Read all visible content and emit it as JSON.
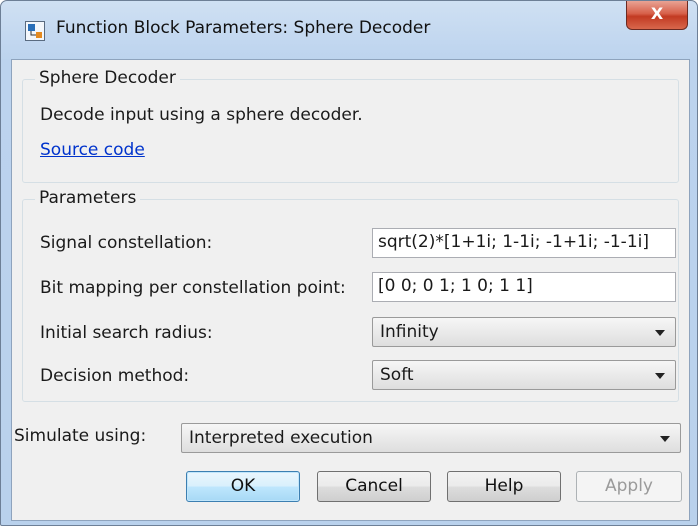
{
  "window": {
    "title": "Function Block Parameters: Sphere Decoder",
    "close_symbol": "X"
  },
  "block": {
    "group_title": "Sphere Decoder",
    "description": "Decode input using a sphere decoder.",
    "source_link": "Source code"
  },
  "parameters": {
    "group_title": "Parameters",
    "signal_constellation": {
      "label": "Signal constellation:",
      "value": "sqrt(2)*[1+1i; 1-1i; -1+1i; -1-1i]"
    },
    "bit_mapping": {
      "label": "Bit mapping per constellation point:",
      "value": "[0 0; 0 1; 1 0; 1 1]"
    },
    "initial_search_radius": {
      "label": "Initial search radius:",
      "value": "Infinity"
    },
    "decision_method": {
      "label": "Decision method:",
      "value": "Soft"
    }
  },
  "simulate": {
    "label": "Simulate using:",
    "value": "Interpreted execution"
  },
  "buttons": {
    "ok": "OK",
    "cancel": "Cancel",
    "help": "Help",
    "apply": "Apply"
  },
  "colors": {
    "link": "#0033cc",
    "close_button": "#c23a22",
    "default_button_border": "#3c7fb1",
    "disabled_text": "#9a9a9a"
  }
}
